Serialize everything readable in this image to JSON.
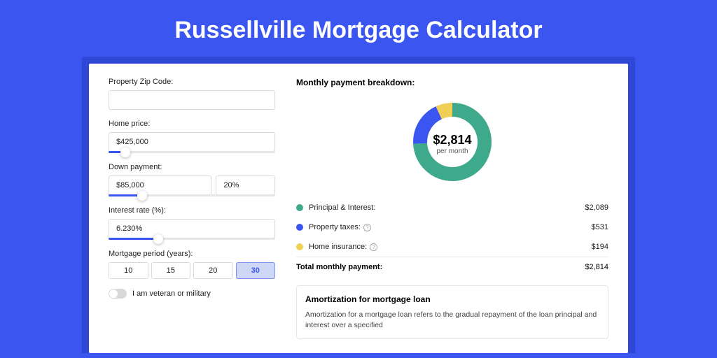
{
  "page_title": "Russellville Mortgage Calculator",
  "left": {
    "zip": {
      "label": "Property Zip Code:",
      "value": ""
    },
    "home_price": {
      "label": "Home price:",
      "value": "$425,000",
      "slider_pct": 10
    },
    "down_payment": {
      "label": "Down payment:",
      "amount": "$85,000",
      "percent": "20%",
      "slider_pct": 20
    },
    "interest": {
      "label": "Interest rate (%):",
      "value": "6.230%",
      "slider_pct": 30
    },
    "period": {
      "label": "Mortgage period (years):",
      "options": [
        "10",
        "15",
        "20",
        "30"
      ],
      "selected": "30"
    },
    "veteran_label": "I am veteran or military"
  },
  "breakdown": {
    "heading": "Monthly payment breakdown:",
    "center_amount": "$2,814",
    "center_sub": "per month",
    "items": [
      {
        "label": "Principal & Interest:",
        "value": "$2,089",
        "color": "#3fa98b",
        "info": false
      },
      {
        "label": "Property taxes:",
        "value": "$531",
        "color": "#3b56f0",
        "info": true
      },
      {
        "label": "Home insurance:",
        "value": "$194",
        "color": "#f0cf54",
        "info": true
      }
    ],
    "total_label": "Total monthly payment:",
    "total_value": "$2,814"
  },
  "amortization": {
    "title": "Amortization for mortgage loan",
    "body": "Amortization for a mortgage loan refers to the gradual repayment of the loan principal and interest over a specified"
  },
  "chart_data": {
    "type": "pie",
    "series": [
      {
        "name": "Principal & Interest",
        "value": 2089,
        "color": "#3fa98b"
      },
      {
        "name": "Property taxes",
        "value": 531,
        "color": "#3b56f0"
      },
      {
        "name": "Home insurance",
        "value": 194,
        "color": "#f0cf54"
      }
    ],
    "total": 2814,
    "center_label": "$2,814 per month"
  }
}
